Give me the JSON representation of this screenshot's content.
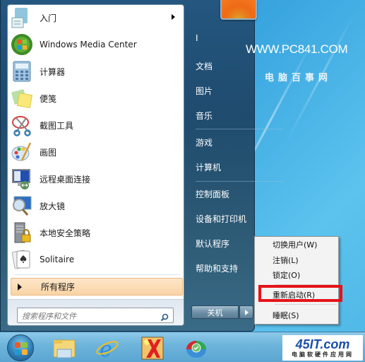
{
  "left_pane": {
    "programs": [
      {
        "label": "入门",
        "icon": "getting-started-icon",
        "has_submenu": true
      },
      {
        "label": "Windows Media Center",
        "icon": "windows-media-center-icon",
        "has_submenu": false
      },
      {
        "label": "计算器",
        "icon": "calculator-icon",
        "has_submenu": false
      },
      {
        "label": "便笺",
        "icon": "sticky-notes-icon",
        "has_submenu": false
      },
      {
        "label": "截图工具",
        "icon": "snipping-tool-icon",
        "has_submenu": false
      },
      {
        "label": "画图",
        "icon": "paint-icon",
        "has_submenu": false
      },
      {
        "label": "远程桌面连接",
        "icon": "remote-desktop-icon",
        "has_submenu": false
      },
      {
        "label": "放大镜",
        "icon": "magnifier-icon",
        "has_submenu": false
      },
      {
        "label": "本地安全策略",
        "icon": "local-security-policy-icon",
        "has_submenu": false
      },
      {
        "label": "Solitaire",
        "icon": "solitaire-icon",
        "has_submenu": false
      }
    ],
    "all_programs_label": "所有程序",
    "search": {
      "placeholder": "搜索程序和文件",
      "value": ""
    }
  },
  "right_pane": {
    "items": [
      {
        "label": "I"
      },
      {
        "label": "文档"
      },
      {
        "label": "图片"
      },
      {
        "label": "音乐"
      },
      {
        "label": "游戏"
      },
      {
        "label": "计算机"
      },
      {
        "label": "控制面板"
      },
      {
        "label": "设备和打印机"
      },
      {
        "label": "默认程序"
      },
      {
        "label": "帮助和支持"
      }
    ],
    "shutdown_label": "关机"
  },
  "context_menu": {
    "items": [
      {
        "label": "切换用户(W)"
      },
      {
        "label": "注销(L)"
      },
      {
        "label": "锁定(O)"
      },
      {
        "label": "重新启动(R)",
        "highlighted": true
      },
      {
        "label": "睡眠(S)"
      }
    ],
    "highlight_color": "#e5131a"
  },
  "watermarks": {
    "url": "WWW.PC841.COM",
    "site_name": "电脑百事网",
    "logo_text": "45IT.com",
    "logo_subtitle": "电脑软硬件应用网"
  },
  "taskbar": {
    "items": [
      {
        "name": "start-orb"
      },
      {
        "name": "windows-explorer"
      },
      {
        "name": "internet-explorer"
      },
      {
        "name": "xara-app"
      },
      {
        "name": "backup-app"
      }
    ]
  }
}
